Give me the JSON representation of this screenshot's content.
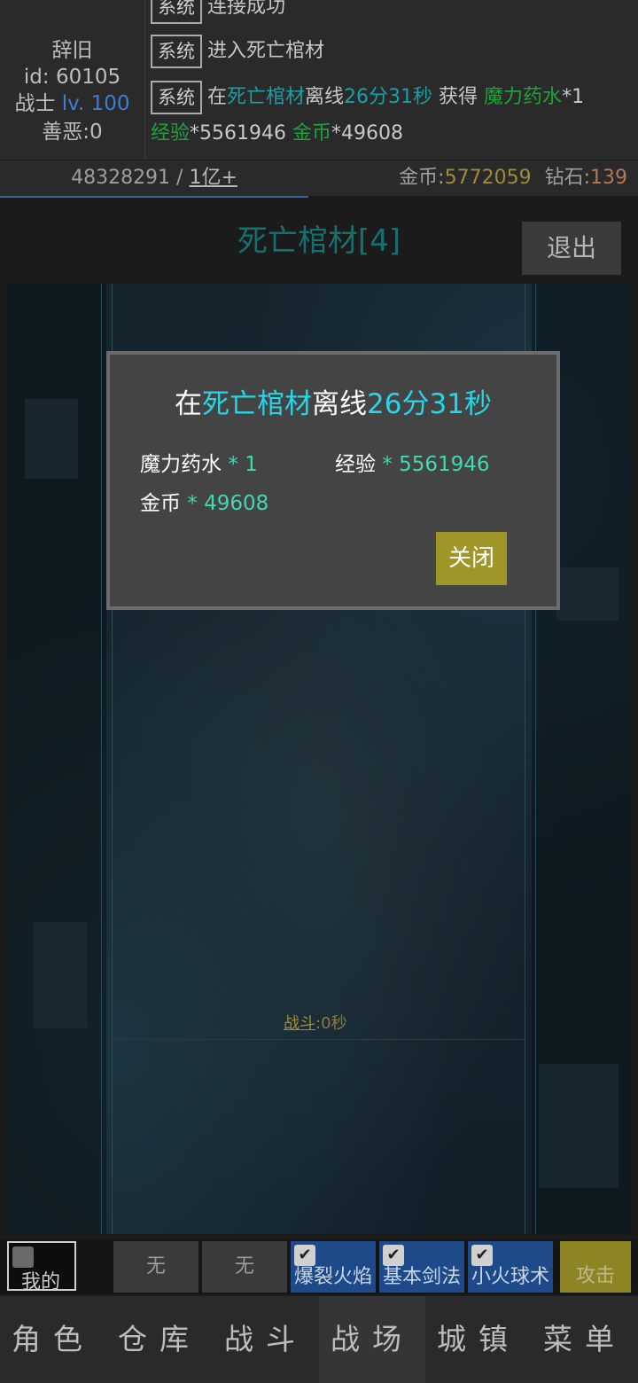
{
  "player": {
    "name": "辞旧",
    "id": "id: 60105",
    "class": "战士",
    "level": "lv. 100",
    "karma": "善恶:0"
  },
  "log": [
    {
      "tag": "系统",
      "text": "连接成功"
    },
    {
      "tag": "系统",
      "text": "进入死亡棺材"
    },
    {
      "tag": "系统",
      "prefix": "在",
      "place": "死亡棺材",
      "mid": "离线",
      "duration": "26分31秒",
      "gain": " 获得 ",
      "item1": "魔力药水",
      "item1_qty": "*1",
      "item2": "经验",
      "item2_qty": "*5561946",
      "item3": "金币",
      "item3_qty": "*49608"
    }
  ],
  "stats": {
    "hp_current": "48328291",
    "hp_sep": " / ",
    "hp_max": "1亿+",
    "gold_label": "金币:",
    "gold_value": "5772059",
    "diamond_label": "钻石:",
    "diamond_value": "139"
  },
  "map": {
    "title": "死亡棺材[4]",
    "exit_label": "退出"
  },
  "battle": {
    "label": "战斗",
    "time": ":0秒"
  },
  "modal": {
    "prefix": "在",
    "place": "死亡棺材",
    "mid": "离线",
    "duration": "26分31秒",
    "rewards": [
      {
        "name": "魔力药水",
        "value": "* 1"
      },
      {
        "name": "经验",
        "value": "* 5561946"
      },
      {
        "name": "金币",
        "value": "* 49608"
      }
    ],
    "close_label": "关闭"
  },
  "skillbar": {
    "mine_label": "我的",
    "slots": [
      "无",
      "无"
    ],
    "skills": [
      "爆裂火焰",
      "基本剑法",
      "小火球术"
    ],
    "check_glyph": "✔",
    "attack_label": "攻击"
  },
  "nav": {
    "items": [
      "角色",
      "仓库",
      "战斗",
      "战场",
      "城镇",
      "菜单"
    ],
    "active_index": 3
  },
  "colors": {
    "accent_teal": "#26d6e8",
    "reward_value": "#40d9b0",
    "close_button": "#9e9628",
    "skill_bg": "#1e4a8a"
  }
}
